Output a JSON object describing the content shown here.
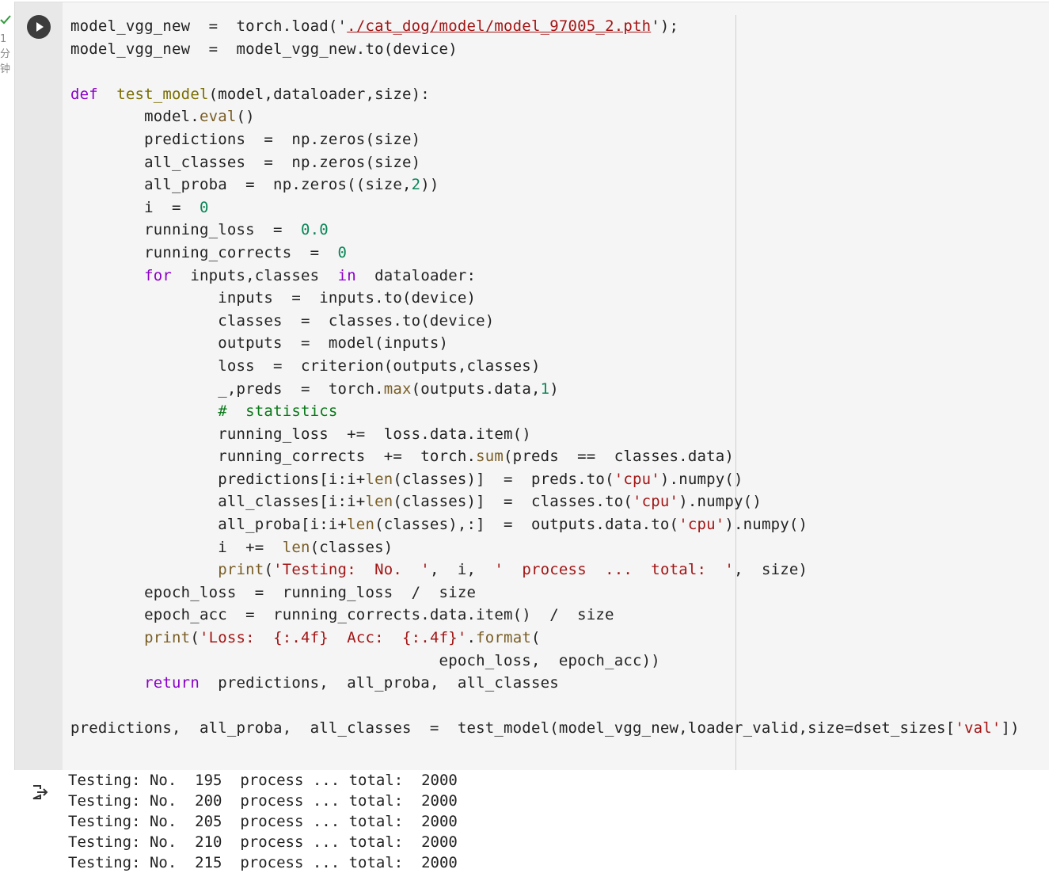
{
  "exec": {
    "status_icon": "check-icon",
    "status_color": "#2e9a3a",
    "meta_lines": [
      "1",
      "分",
      "钟"
    ]
  },
  "cell": {
    "run_icon": "play-icon",
    "code_lines": [
      [
        [
          "",
          "model_vgg_new  =  torch.load('"
        ],
        [
          "link",
          "./cat_dog/model/model_97005_2.pth"
        ],
        [
          "",
          "');"
        ]
      ],
      [
        [
          "",
          "model_vgg_new  =  model_vgg_new.to(device)"
        ]
      ],
      [
        [
          "",
          ""
        ]
      ],
      [
        [
          "kw",
          "def"
        ],
        [
          "",
          "  "
        ],
        [
          "fn",
          "test_model"
        ],
        [
          "",
          "(model,dataloader,size):"
        ]
      ],
      [
        [
          "",
          "        model."
        ],
        [
          "bi",
          "eval"
        ],
        [
          "",
          "()"
        ]
      ],
      [
        [
          "",
          "        predictions  =  np.zeros(size)"
        ]
      ],
      [
        [
          "",
          "        all_classes  =  np.zeros(size)"
        ]
      ],
      [
        [
          "",
          "        all_proba  =  np.zeros((size,"
        ],
        [
          "num",
          "2"
        ],
        [
          "",
          "))"
        ]
      ],
      [
        [
          "",
          "        i  =  "
        ],
        [
          "num",
          "0"
        ]
      ],
      [
        [
          "",
          "        running_loss  =  "
        ],
        [
          "num",
          "0.0"
        ]
      ],
      [
        [
          "",
          "        running_corrects  =  "
        ],
        [
          "num",
          "0"
        ]
      ],
      [
        [
          "",
          "        "
        ],
        [
          "kw",
          "for"
        ],
        [
          "",
          "  inputs,classes  "
        ],
        [
          "kw",
          "in"
        ],
        [
          "",
          "  dataloader:"
        ]
      ],
      [
        [
          "",
          "                inputs  =  inputs.to(device)"
        ]
      ],
      [
        [
          "",
          "                classes  =  classes.to(device)"
        ]
      ],
      [
        [
          "",
          "                outputs  =  model(inputs)"
        ]
      ],
      [
        [
          "",
          "                loss  =  criterion(outputs,classes)"
        ]
      ],
      [
        [
          "",
          "                _,preds  =  torch."
        ],
        [
          "bi",
          "max"
        ],
        [
          "",
          "(outputs.data,"
        ],
        [
          "num",
          "1"
        ],
        [
          "",
          ")"
        ]
      ],
      [
        [
          "",
          "                "
        ],
        [
          "cm",
          "#  statistics"
        ]
      ],
      [
        [
          "",
          "                running_loss  +=  loss.data.item()"
        ]
      ],
      [
        [
          "",
          "                running_corrects  +=  torch."
        ],
        [
          "bi",
          "sum"
        ],
        [
          "",
          "(preds  ==  classes.data)"
        ]
      ],
      [
        [
          "",
          "                predictions[i:i+"
        ],
        [
          "bi",
          "len"
        ],
        [
          "",
          "(classes)]  =  preds.to("
        ],
        [
          "str",
          "'cpu'"
        ],
        [
          "",
          ").numpy()"
        ]
      ],
      [
        [
          "",
          "                all_classes[i:i+"
        ],
        [
          "bi",
          "len"
        ],
        [
          "",
          "(classes)]  =  classes.to("
        ],
        [
          "str",
          "'cpu'"
        ],
        [
          "",
          ").numpy()"
        ]
      ],
      [
        [
          "",
          "                all_proba[i:i+"
        ],
        [
          "bi",
          "len"
        ],
        [
          "",
          "(classes),:]  =  outputs.data.to("
        ],
        [
          "str",
          "'cpu'"
        ],
        [
          "",
          ").numpy()"
        ]
      ],
      [
        [
          "",
          "                i  +=  "
        ],
        [
          "bi",
          "len"
        ],
        [
          "",
          "(classes)"
        ]
      ],
      [
        [
          "",
          "                "
        ],
        [
          "bi",
          "print"
        ],
        [
          "",
          "("
        ],
        [
          "str",
          "'Testing:  No.  '"
        ],
        [
          "",
          ",  i,  "
        ],
        [
          "str",
          "'  process  ...  total:  '"
        ],
        [
          "",
          ",  size)"
        ]
      ],
      [
        [
          "",
          "        epoch_loss  =  running_loss  /  size"
        ]
      ],
      [
        [
          "",
          "        epoch_acc  =  running_corrects.data.item()  /  size"
        ]
      ],
      [
        [
          "",
          "        "
        ],
        [
          "bi",
          "print"
        ],
        [
          "",
          "("
        ],
        [
          "str",
          "'Loss:  {:.4f}  Acc:  {:.4f}'"
        ],
        [
          "",
          "."
        ],
        [
          "bi",
          "format"
        ],
        [
          "",
          "("
        ]
      ],
      [
        [
          "",
          "                                        epoch_loss,  epoch_acc))"
        ]
      ],
      [
        [
          "",
          "        "
        ],
        [
          "kw",
          "return"
        ],
        [
          "",
          "  predictions,  all_proba,  all_classes"
        ]
      ],
      [
        [
          "",
          ""
        ]
      ],
      [
        [
          "",
          "predictions,  all_proba,  all_classes  =  test_model(model_vgg_new,loader_valid,size=dset_sizes["
        ],
        [
          "str",
          "'val'"
        ],
        [
          "",
          "])"
        ]
      ]
    ]
  },
  "output": {
    "icon": "output-redirect-icon",
    "lines": [
      "Testing: No.  195  process ... total:  2000",
      "Testing: No.  200  process ... total:  2000",
      "Testing: No.  205  process ... total:  2000",
      "Testing: No.  210  process ... total:  2000",
      "Testing: No.  215  process ... total:  2000"
    ]
  }
}
